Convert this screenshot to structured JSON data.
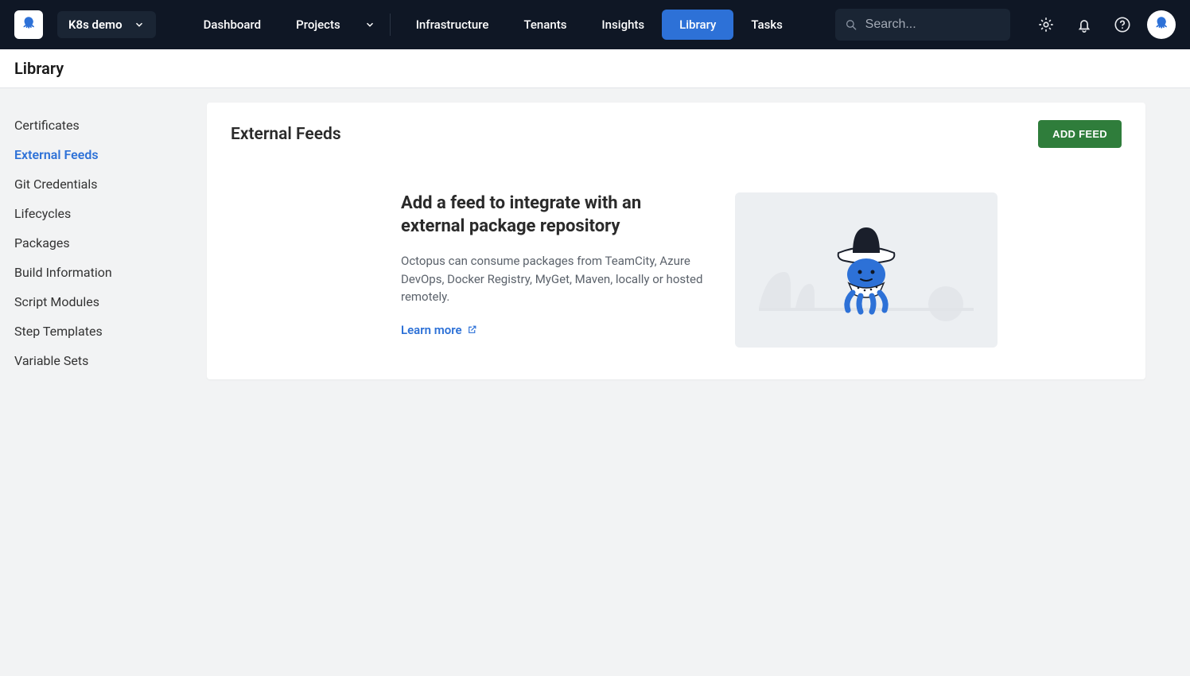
{
  "header": {
    "space_name": "K8s demo",
    "nav": {
      "dashboard": "Dashboard",
      "projects": "Projects",
      "infrastructure": "Infrastructure",
      "tenants": "Tenants",
      "insights": "Insights",
      "library": "Library",
      "tasks": "Tasks"
    },
    "search_placeholder": "Search..."
  },
  "secondary_title": "Library",
  "sidebar": {
    "items": [
      {
        "label": "Certificates",
        "active": false
      },
      {
        "label": "External Feeds",
        "active": true
      },
      {
        "label": "Git Credentials",
        "active": false
      },
      {
        "label": "Lifecycles",
        "active": false
      },
      {
        "label": "Packages",
        "active": false
      },
      {
        "label": "Build Information",
        "active": false
      },
      {
        "label": "Script Modules",
        "active": false
      },
      {
        "label": "Step Templates",
        "active": false
      },
      {
        "label": "Variable Sets",
        "active": false
      }
    ]
  },
  "content": {
    "title": "External Feeds",
    "add_button": "ADD FEED",
    "empty": {
      "heading": "Add a feed to integrate with an external package repository",
      "description": "Octopus can consume packages from TeamCity, Azure DevOps, Docker Registry, MyGet, Maven, locally or hosted remotely.",
      "learn_more": "Learn more"
    }
  }
}
